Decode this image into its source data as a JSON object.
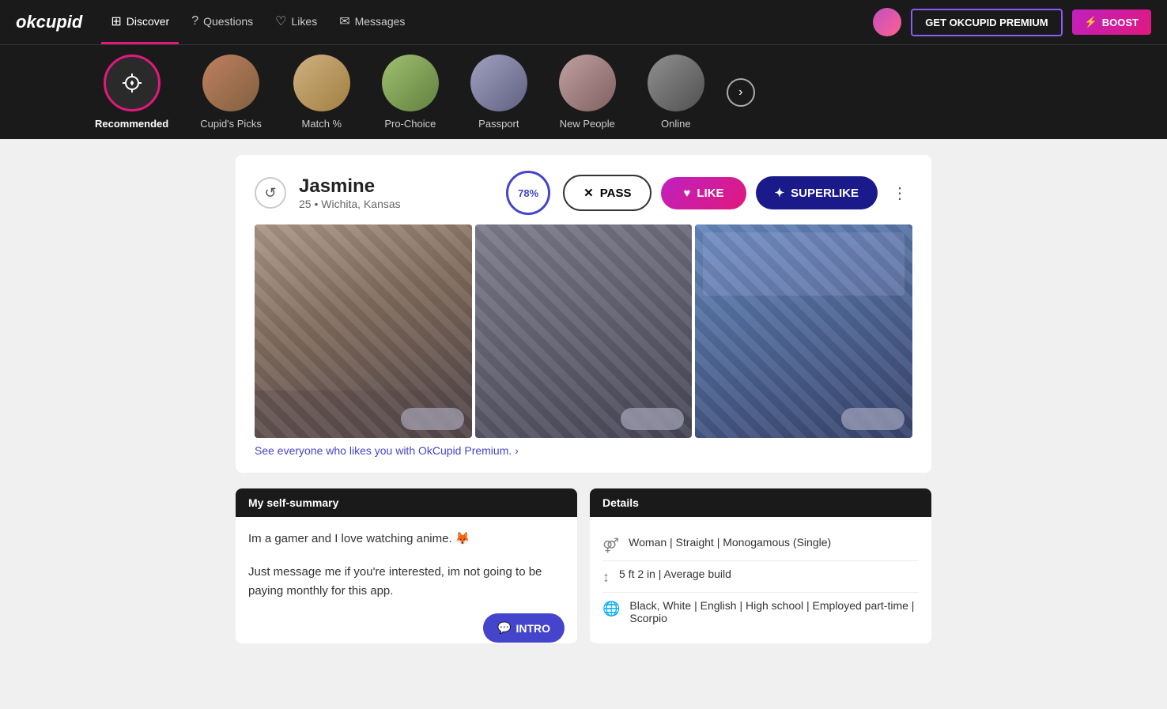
{
  "app": {
    "logo": "okcupid",
    "premium_button": "GET OKCUPID PREMIUM",
    "boost_button": "⚡ BOOST"
  },
  "nav": {
    "items": [
      {
        "id": "discover",
        "label": "Discover",
        "icon": "⊞",
        "active": true
      },
      {
        "id": "questions",
        "label": "Questions",
        "icon": "?"
      },
      {
        "id": "likes",
        "label": "Likes",
        "icon": "♡"
      },
      {
        "id": "messages",
        "label": "Messages",
        "icon": "✉"
      }
    ]
  },
  "categories": [
    {
      "id": "recommended",
      "label": "Recommended",
      "active": true
    },
    {
      "id": "cupids-picks",
      "label": "Cupid's Picks",
      "active": false
    },
    {
      "id": "match",
      "label": "Match %",
      "active": false
    },
    {
      "id": "pro-choice",
      "label": "Pro-Choice",
      "active": false
    },
    {
      "id": "passport",
      "label": "Passport",
      "active": false
    },
    {
      "id": "new-people",
      "label": "New People",
      "active": false
    },
    {
      "id": "online",
      "label": "Online",
      "active": false
    }
  ],
  "profile": {
    "name": "Jasmine",
    "age": "25",
    "location": "Wichita, Kansas",
    "match_percent": "78%",
    "actions": {
      "pass": "PASS",
      "like": "LIKE",
      "superlike": "SUPERLIKE"
    },
    "premium_prompt": "See everyone who likes you with OkCupid Premium. ›",
    "self_summary": {
      "header": "My self-summary",
      "text1": "Im a gamer and I love watching anime. 🦊",
      "text2": "Just message me if you're interested, im not going to be paying monthly for this app.",
      "intro_button": "INTRO"
    },
    "details": {
      "header": "Details",
      "rows": [
        {
          "icon": "⚤",
          "text": "Woman | Straight | Monogamous (Single)"
        },
        {
          "icon": "↕",
          "text": "5 ft 2 in | Average build"
        },
        {
          "icon": "🌐",
          "text": "Black, White | English | High school | Employed part-time | Scorpio"
        }
      ]
    }
  }
}
